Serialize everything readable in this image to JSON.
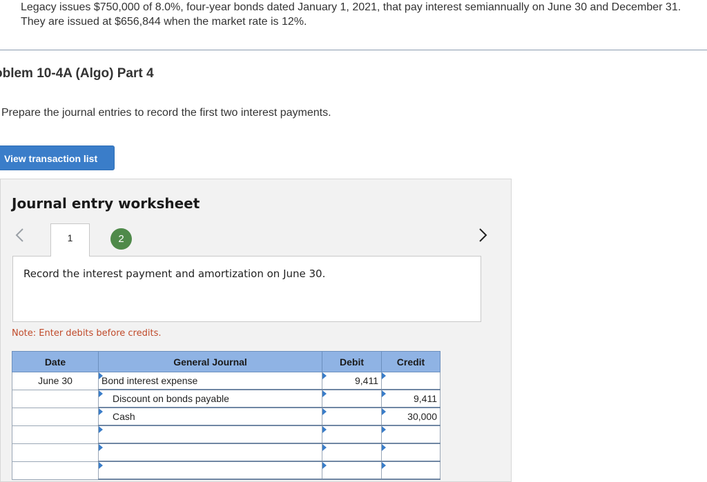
{
  "intro": "Legacy issues $750,000 of 8.0%, four-year bonds dated January 1, 2021, that pay interest semiannually on June 30 and December 31. They are issued at $656,844 when the market rate is 12%.",
  "problem_title": "oblem 10-4A (Algo) Part 4",
  "prompt": "Prepare the journal entries to record the first two interest payments.",
  "view_transaction_list": "View transaction list",
  "worksheet": {
    "title": "Journal entry worksheet",
    "tabs": [
      {
        "label": "1",
        "active": true
      },
      {
        "label": "2",
        "active": false
      }
    ],
    "record_text": "Record the interest payment and amortization on June 30.",
    "note": "Note: Enter debits before credits.",
    "headers": {
      "date": "Date",
      "journal": "General Journal",
      "debit": "Debit",
      "credit": "Credit"
    },
    "rows": [
      {
        "date": "June 30",
        "account": "Bond interest expense",
        "debit": "9,411",
        "credit": ""
      },
      {
        "date": "",
        "account": "Discount on bonds payable",
        "debit": "",
        "credit": "9,411"
      },
      {
        "date": "",
        "account": "Cash",
        "debit": "",
        "credit": "30,000"
      },
      {
        "date": "",
        "account": "",
        "debit": "",
        "credit": ""
      },
      {
        "date": "",
        "account": "",
        "debit": "",
        "credit": ""
      },
      {
        "date": "",
        "account": "",
        "debit": "",
        "credit": ""
      }
    ]
  },
  "colors": {
    "accent": "#3a7dc9",
    "header": "#8fb3e4",
    "tab_active_badge": "#4f8a4a",
    "note": "#c04a2a"
  },
  "icons": {
    "prev": "chevron-left-icon",
    "next": "chevron-right-icon"
  }
}
